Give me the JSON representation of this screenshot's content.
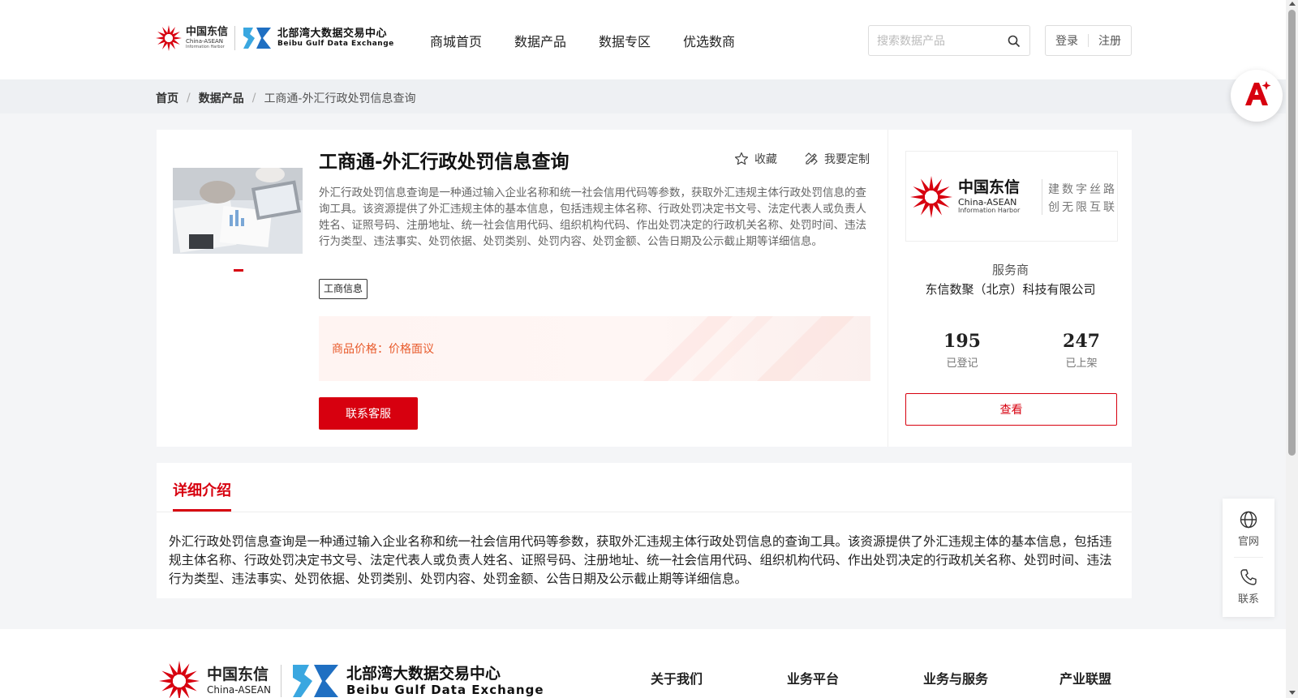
{
  "header": {
    "logo_ct_cn": "中国东信",
    "logo_ct_en1": "China-ASEAN",
    "logo_ct_en2": "Information Harbor",
    "logo_bg_cn": "北部湾大数据交易中心",
    "logo_bg_en": "Beibu Gulf Data Exchange",
    "nav": [
      "商城首页",
      "数据产品",
      "数据专区",
      "优选数商"
    ],
    "search_placeholder": "搜索数据产品",
    "login": "登录",
    "register": "注册"
  },
  "breadcrumb": {
    "home": "首页",
    "section": "数据产品",
    "current": "工商通-外汇行政处罚信息查询"
  },
  "product": {
    "title": "工商通-外汇行政处罚信息查询",
    "favorite_label": "收藏",
    "customize_label": "我要定制",
    "description": "外汇行政处罚信息查询是一种通过输入企业名称和统一社会信用代码等参数，获取外汇违规主体行政处罚信息的查询工具。该资源提供了外汇违规主体的基本信息，包括违规主体名称、行政处罚决定书文号、法定代表人或负责人姓名、证照号码、注册地址、统一社会信用代码、组织机构代码、作出处罚决定的行政机关名称、处罚时间、违法行为类型、违法事实、处罚依据、处罚类别、处罚内容、处罚金额、公告日期及公示截止期等详细信息。",
    "tag": "工商信息",
    "price_label": "商品价格：",
    "price_value": "价格面议",
    "contact_button": "联系客服"
  },
  "vendor": {
    "logo_cn": "中国东信",
    "logo_en1": "China-ASEAN",
    "logo_en2": "Information Harbor",
    "slogan_line1": "建数字丝路",
    "slogan_line2": "创无限互联",
    "label": "服务商",
    "name": "东信数聚（北京）科技有限公司",
    "registered_count": "195",
    "registered_label": "已登记",
    "listed_count": "247",
    "listed_label": "已上架",
    "view_button": "查看"
  },
  "detail": {
    "tab": "详细介绍",
    "text": "外汇行政处罚信息查询是一种通过输入企业名称和统一社会信用代码等参数，获取外汇违规主体行政处罚信息的查询工具。该资源提供了外汇违规主体的基本信息，包括违规主体名称、行政处罚决定书文号、法定代表人或负责人姓名、证照号码、注册地址、统一社会信用代码、组织机构代码、作出处罚决定的行政机关名称、处罚时间、违法行为类型、违法事实、处罚依据、处罚类别、处罚内容、处罚金额、公告日期及公示截止期等详细信息。"
  },
  "side": {
    "website": "官网",
    "contact": "联系"
  },
  "footer": {
    "links": [
      "关于我们",
      "业务平台",
      "业务与服务",
      "产业联盟"
    ]
  },
  "colors": {
    "brand_red": "#d7000f",
    "price_orange": "#e85a2b",
    "logo_blue": "#1f8fd6"
  },
  "icons": [
    "search-icon",
    "star-icon",
    "customize-icon",
    "globe-icon",
    "phone-icon",
    "ai-assistant-icon"
  ]
}
